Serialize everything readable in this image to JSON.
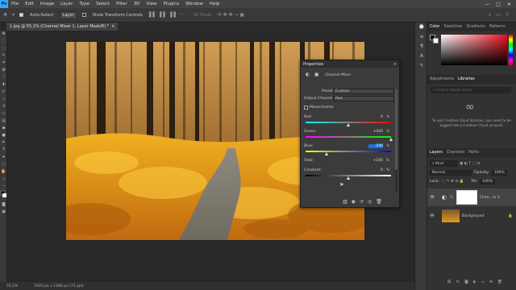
{
  "menubar": {
    "logo": "Ps",
    "items": [
      "File",
      "Edit",
      "Image",
      "Layer",
      "Type",
      "Select",
      "Filter",
      "3D",
      "View",
      "Plugins",
      "Window",
      "Help"
    ],
    "window_controls": [
      "—",
      "□",
      "✕"
    ]
  },
  "options": {
    "auto_select_label": "Auto-Select:",
    "auto_select_value": "Layer",
    "show_transform_label": "Show Transform Controls",
    "mode_3d_label": "3D Mode:"
  },
  "document_tab": {
    "title": "1.jpg @ 55,1% (Channel Mixer 1, Layer Mask/8) *",
    "close": "×"
  },
  "status": {
    "zoom": "55,1%",
    "doc_info": "1920 px x 1280 px (72 ppi)"
  },
  "color_panel": {
    "tabs": [
      "Color",
      "Swatches",
      "Gradients",
      "Patterns"
    ],
    "active_tab": "Color"
  },
  "libraries_panel": {
    "tabs": [
      "Adjustments",
      "Libraries"
    ],
    "active_tab": "Libraries",
    "search_placeholder": "Search Adobe Stock",
    "message": "To use Creative Cloud libraries, you need to be logged into a Creative Cloud account."
  },
  "layers_panel": {
    "tabs": [
      "Layers",
      "Channels",
      "Paths"
    ],
    "active_tab": "Layers",
    "filter_kind": "Kind",
    "blend_mode": "Normal",
    "opacity_label": "Opacity:",
    "opacity_value": "100%",
    "lock_label": "Lock:",
    "fill_label": "Fill:",
    "fill_value": "100%",
    "layers": [
      {
        "name": "Chan...er 1",
        "type": "adjustment"
      },
      {
        "name": "Background",
        "type": "image"
      }
    ]
  },
  "properties": {
    "title": "Properties",
    "adjustment_name": "Channel Mixer",
    "preset_label": "Preset:",
    "preset_value": "Custom",
    "output_channel_label": "Output Channel:",
    "output_channel_value": "Red",
    "monochrome_label": "Monochrome",
    "sliders": [
      {
        "label": "Red:",
        "value": "0",
        "unit": "%",
        "fraction": 0.5
      },
      {
        "label": "Green:",
        "value": "+200",
        "unit": "%",
        "fraction": 1.0
      },
      {
        "label": "Blue:",
        "value": "-100",
        "unit": "%",
        "fraction": 0.25
      }
    ],
    "total_label": "Total:",
    "total_value": "+100",
    "total_unit": "%",
    "constant_label": "Constant:",
    "constant_value": "0",
    "constant_unit": "%",
    "constant_fraction": 0.5
  },
  "colors": {
    "ps_blue": "#31a8ff",
    "highlight": "#1473e6",
    "foliage": "#e8a21a"
  }
}
